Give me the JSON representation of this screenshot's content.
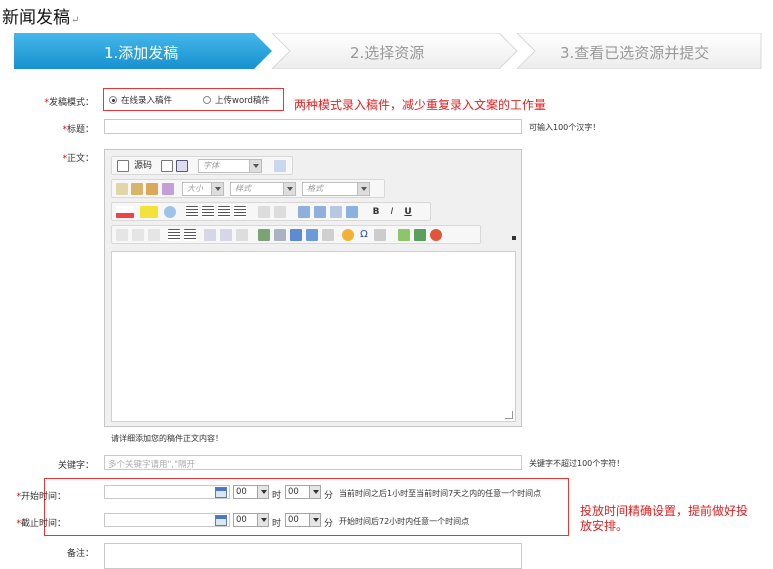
{
  "doc": {
    "title": "新闻发稿",
    "pilcrow": "↵"
  },
  "steps": [
    {
      "label": "1.添加发稿",
      "active": true
    },
    {
      "label": "2.选择资源",
      "active": false
    },
    {
      "label": "3.查看已选资源并提交",
      "active": false
    }
  ],
  "colors": {
    "active_step": "#2aa3dd",
    "annotation": "#e02020",
    "required": "#e00000"
  },
  "form": {
    "required_mark": "*",
    "mode": {
      "label": "发稿模式：",
      "options": [
        "在线录入稿件",
        "上传word稿件"
      ],
      "selected": 0,
      "annotation": "两种模式录入稿件，减少重复录入文案的工作量"
    },
    "title": {
      "label": "标题：",
      "hint": "可输入100个汉字！",
      "value": ""
    },
    "body": {
      "label": "正文：",
      "source_label": "源码",
      "font_combo": "字体",
      "size_combo": "大小",
      "style_combo": "样式",
      "format_combo": "格式",
      "help": "请详细添加您的稿件正文内容！"
    },
    "keywords": {
      "label": "关键字：",
      "placeholder": "多个关键字请用\",\"隔开",
      "hint": "关键字不超过100个字符！"
    },
    "start": {
      "label": "开始时间：",
      "hour": "00",
      "minute": "00",
      "hour_unit": "时",
      "minute_unit": "分",
      "hint": "当前时间之后1小时至当前时间7天之内的任意一个时间点"
    },
    "end": {
      "label": "截止时间：",
      "hour": "00",
      "minute": "00",
      "hour_unit": "时",
      "minute_unit": "分",
      "hint": "开始时间后72小时内任意一个时间点"
    },
    "time_annotation_1": "投放时间精确设置，提前做好投",
    "time_annotation_2": "放安排。",
    "remark": {
      "label": "备注："
    }
  }
}
